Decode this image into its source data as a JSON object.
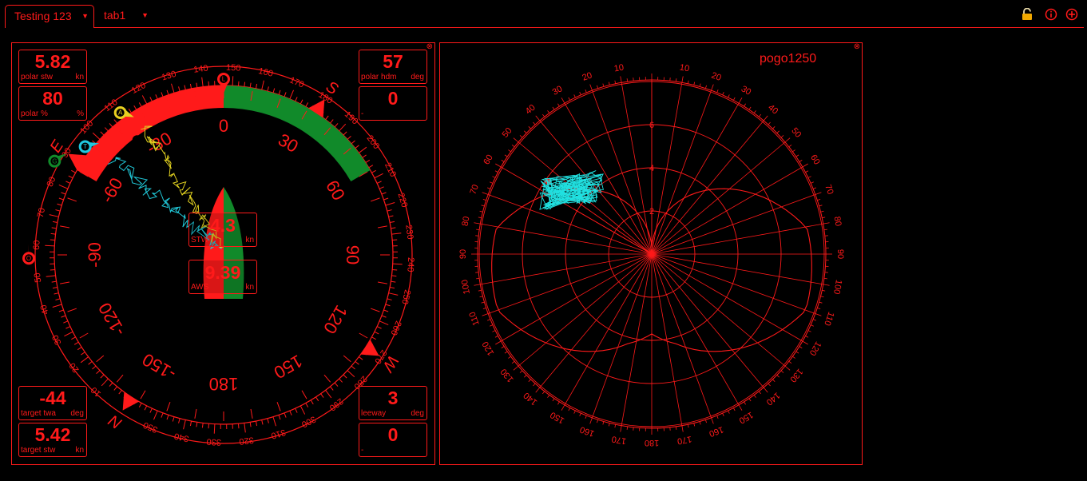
{
  "tabs": [
    {
      "label": "Testing 123",
      "active": true
    },
    {
      "label": "tab1",
      "active": false
    }
  ],
  "toolbar_icons": [
    "lock-icon",
    "info-icon",
    "add-icon"
  ],
  "colors": {
    "primary": "#ff1a1a",
    "starboard": "#118a2a",
    "background": "#000000",
    "track_port": "#20c8d8",
    "track_stbd": "#e0d020",
    "polar_track": "#20e0e0"
  },
  "gauges": {
    "polar_stw": {
      "value": "5.82",
      "label": "polar stw",
      "unit": "kn"
    },
    "polar_pct": {
      "value": "80",
      "label": "polar %",
      "unit": "%"
    },
    "polar_hdm": {
      "value": "57",
      "label": "polar hdm",
      "unit": "deg"
    },
    "box_top_right2": {
      "value": "0",
      "label": "-",
      "unit": ""
    },
    "target_twa": {
      "value": "-44",
      "label": "target twa",
      "unit": "deg"
    },
    "target_stw": {
      "value": "5.42",
      "label": "target stw",
      "unit": "kn"
    },
    "leeway": {
      "value": "3",
      "label": "leeway",
      "unit": "deg"
    },
    "box_bottom_right2": {
      "value": "0",
      "label": "-",
      "unit": ""
    }
  },
  "compass": {
    "stw": {
      "value": "4.3",
      "label": "STW",
      "unit": "kn"
    },
    "aws": {
      "value": "9.39",
      "label": "AWS",
      "unit": "kn"
    },
    "cardinals": [
      "N",
      "E",
      "S",
      "W"
    ],
    "wind_angle_labels": [
      "0",
      "30",
      "60",
      "90",
      "120",
      "150",
      "180",
      "-150",
      "-120",
      "-90",
      "-60",
      "-30"
    ],
    "outer_labels": [
      "10",
      "20",
      "30",
      "40",
      "50",
      "60",
      "70",
      "80",
      "90",
      "100",
      "110",
      "120",
      "130",
      "140",
      "150",
      "160",
      "170",
      "180",
      "190",
      "200",
      "210",
      "220",
      "230",
      "240",
      "250",
      "260",
      "270",
      "280",
      "290",
      "300",
      "310",
      "320",
      "330",
      "340",
      "350"
    ],
    "markers": [
      "L",
      "G",
      "T",
      "A",
      "O"
    ]
  },
  "polar": {
    "title": "pogo1250",
    "speed_labels": [
      "2",
      "4",
      "6"
    ],
    "angle_labels": [
      "10",
      "20",
      "30",
      "40",
      "50",
      "60",
      "70",
      "80",
      "90",
      "100",
      "110",
      "120",
      "130",
      "140",
      "150",
      "160",
      "170",
      "180"
    ]
  }
}
